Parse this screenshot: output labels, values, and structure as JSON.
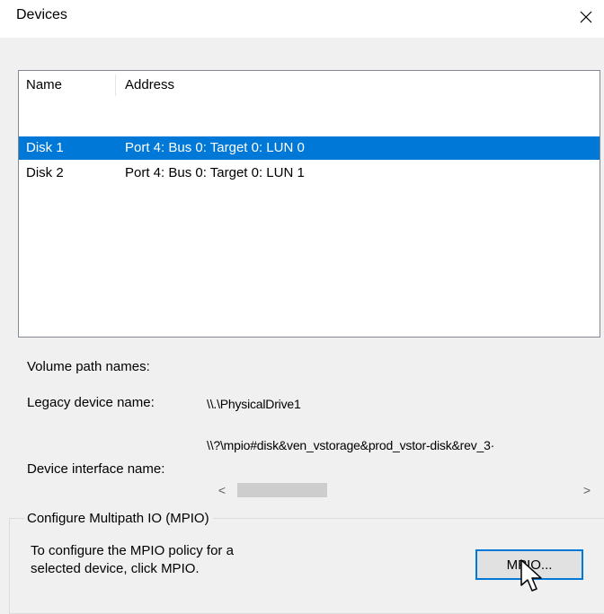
{
  "window": {
    "title": "Devices",
    "close_glyph": "✕"
  },
  "device_list": {
    "columns": [
      "Name",
      "Address"
    ],
    "rows": [
      {
        "name": "Disk 1",
        "address": "Port 4: Bus 0: Target 0: LUN 0",
        "selected": true
      },
      {
        "name": "Disk 2",
        "address": "Port 4: Bus 0: Target 0: LUN 1",
        "selected": false
      }
    ]
  },
  "details": {
    "volume_path_label": "Volume path names:",
    "legacy_label": "Legacy device name:",
    "legacy_value": "\\\\.\\PhysicalDrive1",
    "interface_label": "Device interface name:",
    "interface_value": "\\\\?\\mpio#disk&ven_vstorage&prod_vstor-disk&rev_3·"
  },
  "scrollbar": {
    "left_arrow": "<",
    "right_arrow": ">"
  },
  "mpio_group": {
    "legend": "Configure Multipath IO (MPIO)",
    "description": "To configure the MPIO policy for a\nselected device, click MPIO.",
    "button_label": "MPIO..."
  },
  "icons": {
    "close": "close-icon",
    "cursor": "mouse-pointer-icon"
  },
  "colors": {
    "selection": "#0078d7",
    "dialog_background": "#f0f0f0",
    "button_border": "#0078d7"
  }
}
